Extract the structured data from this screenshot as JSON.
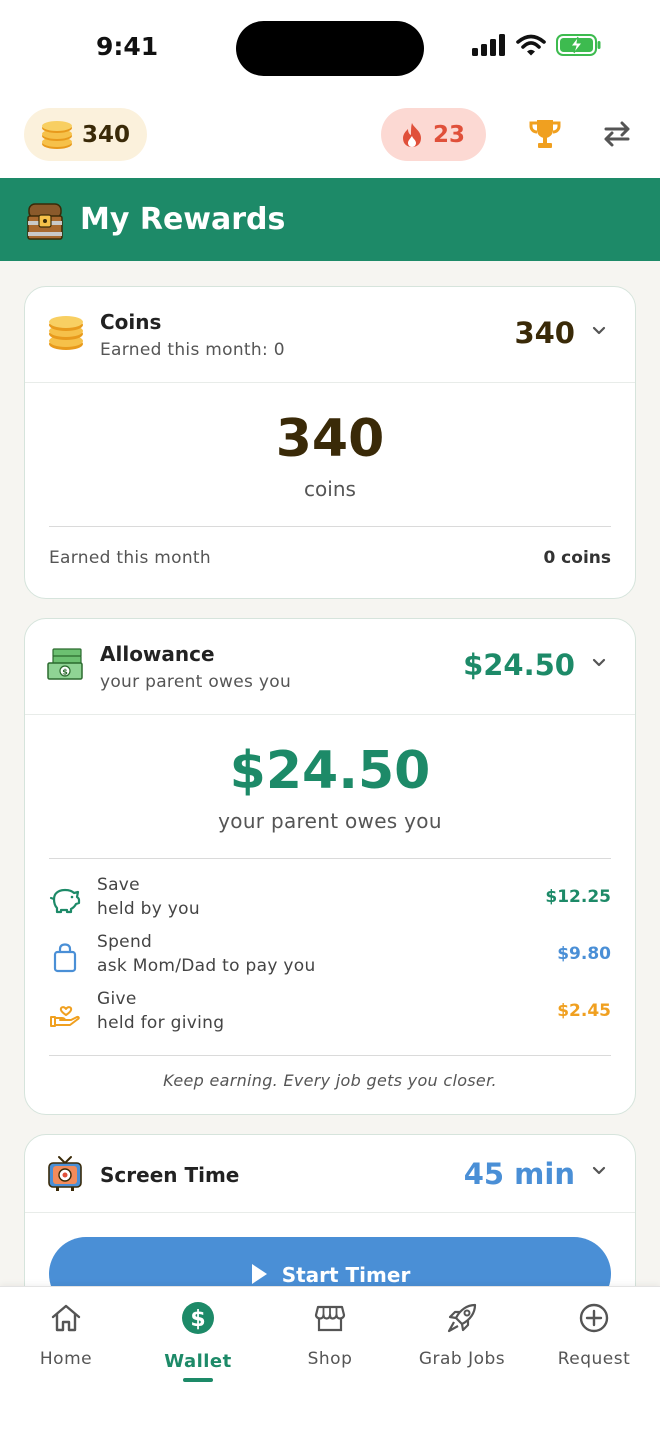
{
  "status_bar": {
    "time": "9:41"
  },
  "top_bar": {
    "coins": "340",
    "streak": "23"
  },
  "header": {
    "title": "My Rewards"
  },
  "coins_card": {
    "title": "Coins",
    "subtitle": "Earned this month: 0",
    "amount": "340",
    "big_value": "340",
    "big_label": "coins",
    "row_label": "Earned this month",
    "row_value": "0 coins"
  },
  "allowance_card": {
    "title": "Allowance",
    "subtitle": "your parent owes you",
    "amount": "$24.50",
    "big_value": "$24.50",
    "big_label": "your parent owes you",
    "buckets": [
      {
        "name": "Save",
        "note": "held by you",
        "amount": "$12.25",
        "color": "#1d8a68",
        "icon": "piggy-bank-icon"
      },
      {
        "name": "Spend",
        "note": "ask Mom/Dad to pay you",
        "amount": "$9.80",
        "color": "#4a8fd6",
        "icon": "shopping-bag-icon"
      },
      {
        "name": "Give",
        "note": "held for giving",
        "amount": "$2.45",
        "color": "#f0a020",
        "icon": "heart-hand-icon"
      }
    ],
    "footer": "Keep earning. Every job gets you closer."
  },
  "screen_time_card": {
    "title": "Screen Time",
    "amount": "45 min",
    "button_label": "Start Timer"
  },
  "bottom_nav": [
    {
      "label": "Home",
      "icon": "home-icon"
    },
    {
      "label": "Wallet",
      "icon": "dollar-icon",
      "active": true
    },
    {
      "label": "Shop",
      "icon": "store-icon"
    },
    {
      "label": "Grab Jobs",
      "icon": "rocket-icon"
    },
    {
      "label": "Request",
      "icon": "plus-circle-icon"
    }
  ],
  "colors": {
    "brand_green": "#1d8a68",
    "accent_blue": "#4a8fd6",
    "give_orange": "#f0a020",
    "streak_red": "#e0503a"
  }
}
